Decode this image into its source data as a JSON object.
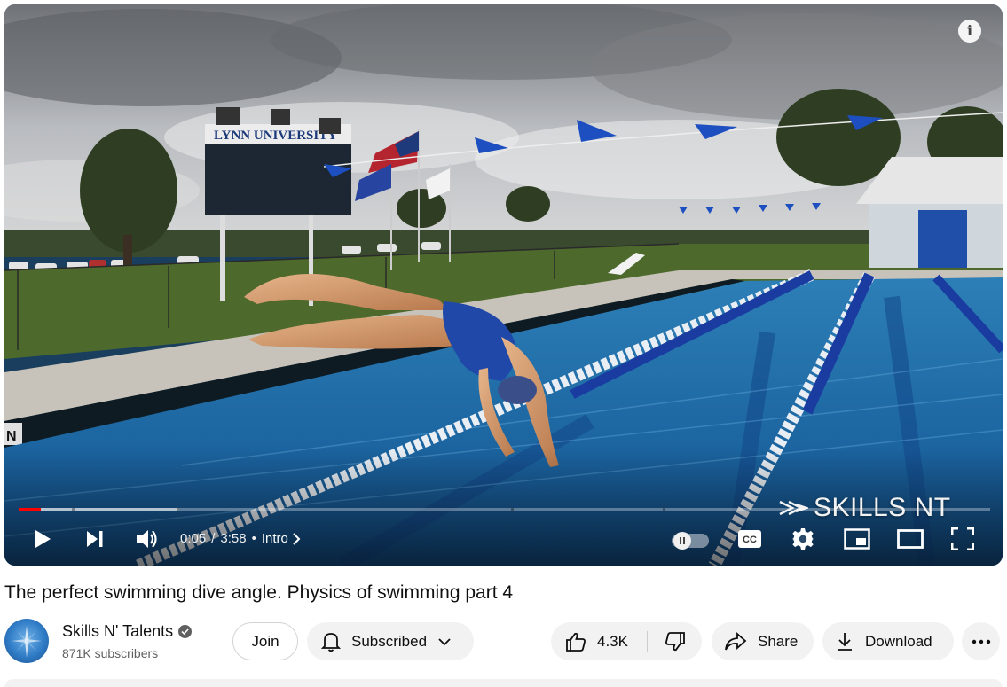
{
  "video": {
    "scoreboard_text": "LYNN UNIVERSITY",
    "lane_marker": "N",
    "watermark": "SKILLS NT",
    "info_glyph": "i",
    "time_current": "0:05",
    "time_separator": "/",
    "time_total": "3:58",
    "chapter_bullet": "•",
    "chapter": "Intro",
    "progress_played": 0.023,
    "progress_loaded": 0.165,
    "autoplay": "off",
    "colors": {
      "progress_played": "#ff0000",
      "pool": "#1f6ea8"
    },
    "icons": {
      "play": "play-icon",
      "next": "next-icon",
      "volume": "volume-icon",
      "autoplay": "autoplay-toggle",
      "captions": "cc-icon",
      "settings": "gear-icon",
      "miniplayer": "miniplayer-icon",
      "theater": "theater-icon",
      "fullscreen": "fullscreen-icon",
      "info": "info-icon"
    },
    "cc_label": "CC"
  },
  "title": "The perfect swimming dive angle. Physics of swimming part 4",
  "channel": {
    "name": "Skills N' Talents",
    "subscribers": "871K subscribers",
    "verified": true
  },
  "actions": {
    "join": "Join",
    "subscribed": "Subscribed",
    "likes": "4.3K",
    "share": "Share",
    "download": "Download",
    "more": "more-icon"
  }
}
